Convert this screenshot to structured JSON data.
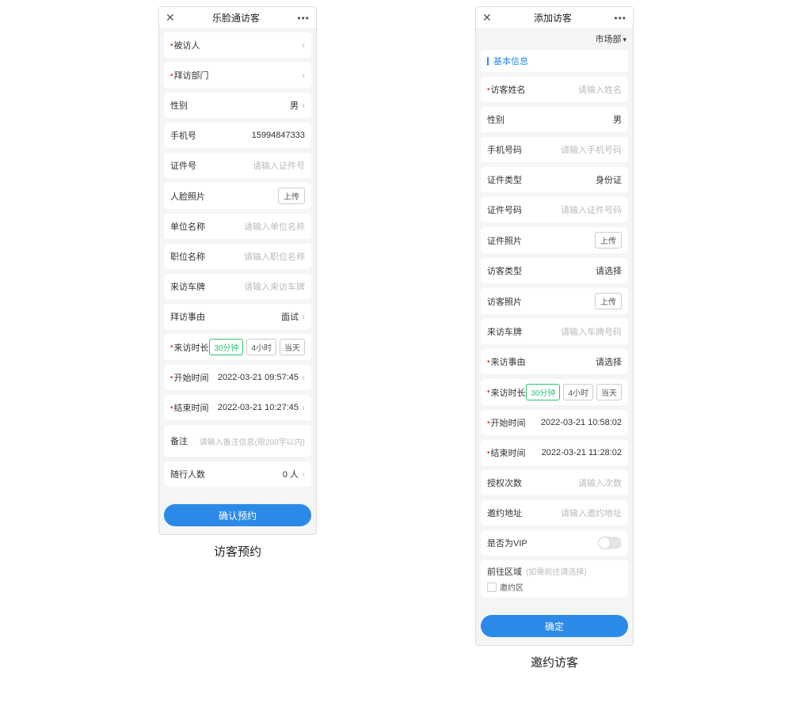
{
  "left": {
    "header_title": "乐脸通访客",
    "caption": "访客预约",
    "primary_btn": "确认预约",
    "rows": {
      "visitedPerson": {
        "label": "被访人"
      },
      "visitDept": {
        "label": "拜访部门"
      },
      "gender": {
        "label": "性别",
        "value": "男"
      },
      "phone": {
        "label": "手机号",
        "value": "15994847333"
      },
      "idNo": {
        "label": "证件号",
        "placeholder": "请输入证件号"
      },
      "facePhoto": {
        "label": "人脸照片",
        "btn": "上传"
      },
      "company": {
        "label": "单位名称",
        "placeholder": "请输入单位名称"
      },
      "position": {
        "label": "职位名称",
        "placeholder": "请输入职位名称"
      },
      "plate": {
        "label": "来访车牌",
        "placeholder": "请输入来访车牌"
      },
      "reason": {
        "label": "拜访事由",
        "value": "面试"
      },
      "duration": {
        "label": "来访时长",
        "opts": [
          "30分钟",
          "4小时",
          "当天"
        ]
      },
      "startTime": {
        "label": "开始时间",
        "value": "2022-03-21 09:57:45"
      },
      "endTime": {
        "label": "结束时间",
        "value": "2022-03-21 10:27:45"
      },
      "remark": {
        "label": "备注",
        "placeholder": "请输入备注信息(限200字以内)"
      },
      "companions": {
        "label": "随行人数",
        "value": "0 人"
      }
    }
  },
  "right": {
    "header_title": "添加访客",
    "dept_selector": "市场部",
    "section_basic": "基本信息",
    "caption": "邀约访客",
    "primary_btn": "确定",
    "rows": {
      "name": {
        "label": "访客姓名",
        "placeholder": "请输入姓名"
      },
      "gender": {
        "label": "性别",
        "value": "男"
      },
      "phone": {
        "label": "手机号码",
        "placeholder": "请输入手机号码"
      },
      "idType": {
        "label": "证件类型",
        "value": "身份证"
      },
      "idNo": {
        "label": "证件号码",
        "placeholder": "请输入证件号码"
      },
      "idPhoto": {
        "label": "证件照片",
        "btn": "上传"
      },
      "visitorType": {
        "label": "访客类型",
        "value": "请选择"
      },
      "visitorPhoto": {
        "label": "访客照片",
        "btn": "上传"
      },
      "plate": {
        "label": "来访车牌",
        "placeholder": "请输入车牌号码"
      },
      "reason": {
        "label": "来访事由",
        "value": "请选择"
      },
      "duration": {
        "label": "来访时长",
        "opts": [
          "30分钟",
          "4小时",
          "当天"
        ]
      },
      "startTime": {
        "label": "开始时间",
        "value": "2022-03-21 10:58:02"
      },
      "endTime": {
        "label": "结束时间",
        "value": "2022-03-21 11:28:02"
      },
      "authCount": {
        "label": "授权次数",
        "placeholder": "请输入次数"
      },
      "inviteAddr": {
        "label": "邀约地址",
        "placeholder": "请输入邀约地址"
      },
      "vip": {
        "label": "是否为VIP"
      },
      "area": {
        "label": "前往区域",
        "hint": "(如需前往请选择)",
        "option": "邀约区"
      }
    }
  }
}
